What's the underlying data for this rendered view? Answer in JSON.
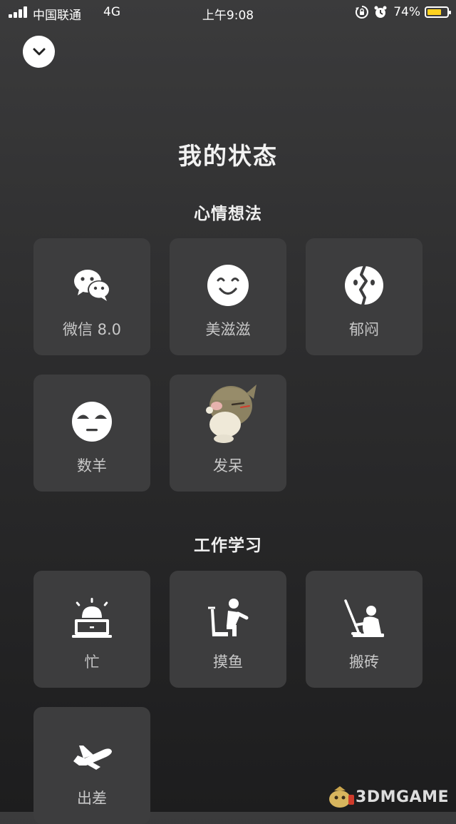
{
  "status_bar": {
    "carrier": "中国联通",
    "network": "4G",
    "time": "上午9:08",
    "battery_percent": "74%",
    "battery_level": 0.74,
    "battery_color": "#ffd21f"
  },
  "header": {
    "collapse_icon": "chevron-down-icon",
    "title": "我的状态"
  },
  "sections": [
    {
      "title": "心情想法",
      "items": [
        {
          "label": "微信 8.0",
          "icon": "wechat-chat-bubbles-icon"
        },
        {
          "label": "美滋滋",
          "icon": "smiling-face-icon"
        },
        {
          "label": "郁闷",
          "icon": "cracked-face-icon"
        },
        {
          "label": "数羊",
          "icon": "sleepy-face-icon"
        },
        {
          "label": "发呆",
          "icon": "daydream-animation-icon"
        }
      ]
    },
    {
      "title": "工作学习",
      "items": [
        {
          "label": "忙",
          "icon": "alarm-laptop-icon"
        },
        {
          "label": "摸鱼",
          "icon": "slacking-at-desk-icon"
        },
        {
          "label": "搬砖",
          "icon": "person-with-pickaxe-icon"
        },
        {
          "label": "出差",
          "icon": "airplane-icon"
        }
      ]
    }
  ],
  "watermark": {
    "text": "3DMGAME"
  }
}
